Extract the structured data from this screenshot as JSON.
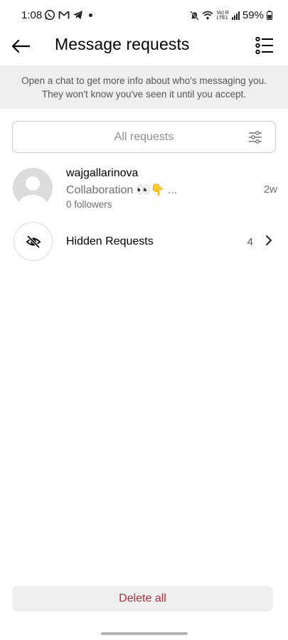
{
  "status_bar": {
    "time": "1:08",
    "left_icons": [
      "whatsapp-icon",
      "gmail-icon",
      "telegram-icon",
      "notification-dot"
    ],
    "volte_line1": "Vo) R",
    "volte_line2": "LTE1",
    "battery_percent": "59%"
  },
  "header": {
    "title": "Message requests",
    "back_icon": "back-arrow-icon",
    "list_icon": "list-options-icon"
  },
  "info_banner": {
    "line1": "Open a chat to get more info about who's messaging you.",
    "line2": "They won't know you've seen it until you accept."
  },
  "filter": {
    "label": "All requests",
    "icon": "filter-sliders-icon"
  },
  "requests": [
    {
      "username": "wajgallarinova",
      "preview": "Collaboration 👀👇 ...",
      "followers": "0 followers",
      "time": "2w"
    }
  ],
  "hidden_requests": {
    "label": "Hidden Requests",
    "count": "4",
    "icon": "eye-off-icon"
  },
  "footer": {
    "delete_all_label": "Delete all",
    "delete_color": "#c0283f"
  }
}
